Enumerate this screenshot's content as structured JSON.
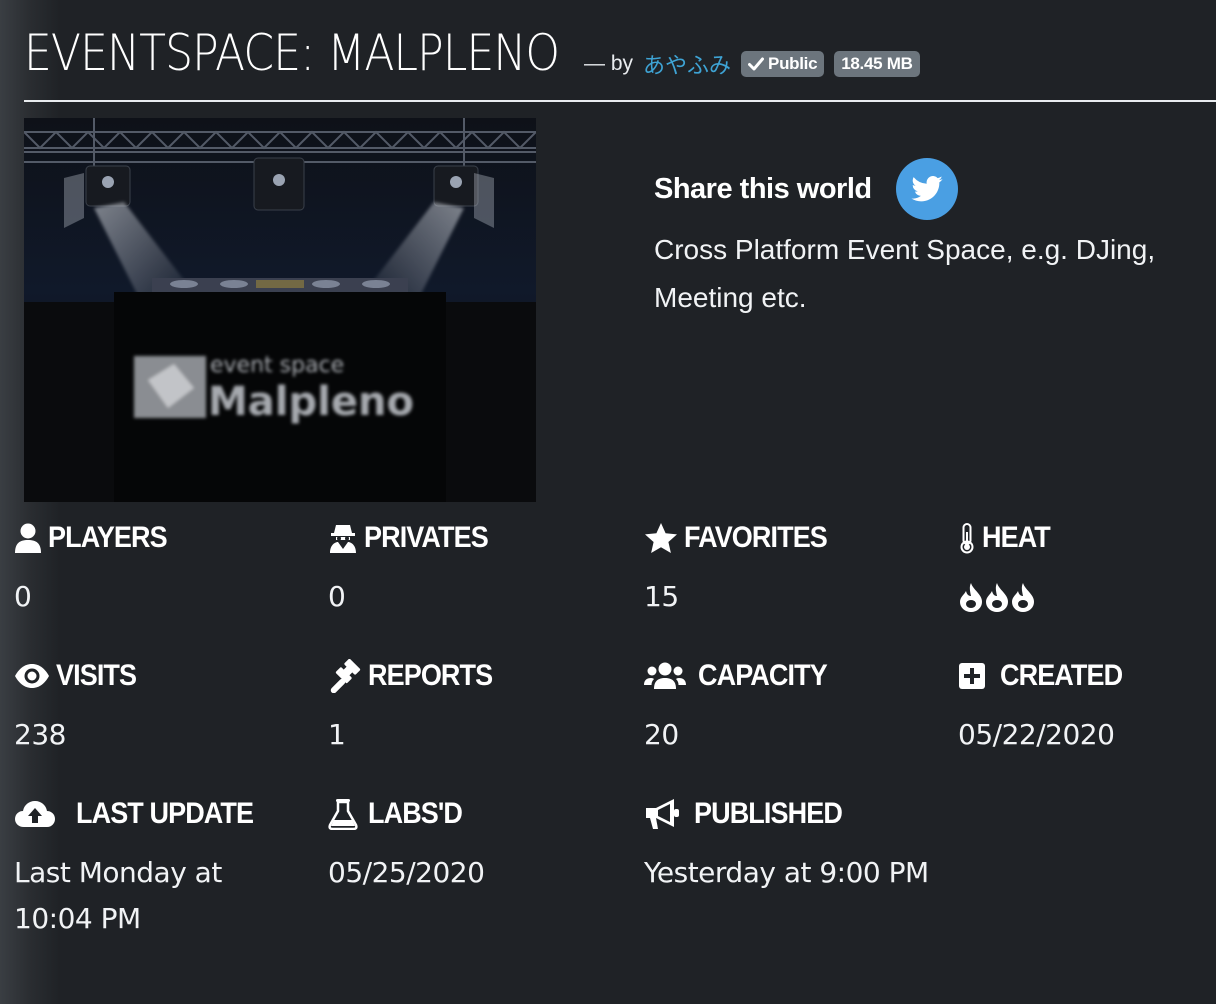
{
  "header": {
    "title": "EVENTSPACE: MALPLENO",
    "by_text": "— by",
    "author": "あやふみ",
    "visibility_badge": "Public",
    "size_badge": "18.45 MB"
  },
  "thumbnail": {
    "line1": "event space",
    "line2": "Malpleno"
  },
  "share": {
    "title": "Share this world",
    "description": "Cross Platform Event Space, e.g. DJing, Meeting etc."
  },
  "stats": {
    "players": {
      "label": "PLAYERS",
      "value": "0",
      "icon": "user-icon"
    },
    "privates": {
      "label": "PRIVATES",
      "value": "0",
      "icon": "user-secret-icon"
    },
    "favorites": {
      "label": "FAVORITES",
      "value": "15",
      "icon": "star-icon"
    },
    "heat": {
      "label": "HEAT",
      "value_level": 3,
      "icon": "thermometer-icon"
    },
    "visits": {
      "label": "VISITS",
      "value": "238",
      "icon": "eye-icon"
    },
    "reports": {
      "label": "REPORTS",
      "value": "1",
      "icon": "gavel-icon"
    },
    "capacity": {
      "label": "CAPACITY",
      "value": "20",
      "icon": "users-icon"
    },
    "created": {
      "label": "CREATED",
      "value": "05/22/2020",
      "icon": "plus-square-icon"
    },
    "last_update": {
      "label": "LAST UPDATE",
      "value": "Last Monday at 10:04 PM",
      "icon": "cloud-upload-icon"
    },
    "labsd": {
      "label": "LABS'D",
      "value": "05/25/2020",
      "icon": "flask-icon"
    },
    "published": {
      "label": "PUBLISHED",
      "value": "Yesterday at 9:00 PM",
      "icon": "bullhorn-icon"
    }
  },
  "colors": {
    "background": "#1f2226",
    "link": "#3ea3d4",
    "badge": "#6c757d",
    "twitter": "#4a9fe3"
  }
}
